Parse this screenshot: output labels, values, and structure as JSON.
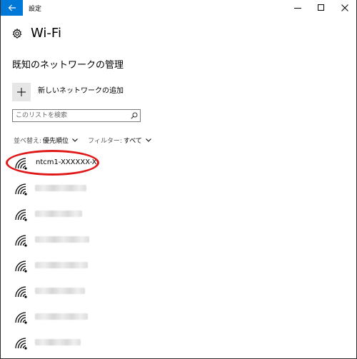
{
  "window": {
    "title": "設定",
    "accent": "#0078d7"
  },
  "header": {
    "title": "Wi-Fi"
  },
  "section": {
    "title": "既知のネットワークの管理"
  },
  "add_network": {
    "label": "新しいネットワークの追加"
  },
  "search": {
    "placeholder": "このリストを検索",
    "value": ""
  },
  "filters": {
    "sort_label": "並べ替え:",
    "sort_value": "優先順位",
    "filter_label": "フィルター:",
    "filter_value": "すべて"
  },
  "networks": [
    {
      "name": "ntcm1-XXXXXX-X",
      "highlighted": true
    },
    {
      "name": ""
    },
    {
      "name": ""
    },
    {
      "name": ""
    },
    {
      "name": ""
    },
    {
      "name": ""
    },
    {
      "name": ""
    },
    {
      "name": ""
    }
  ],
  "icons": {
    "back": "arrow-left",
    "minimize": "minimize",
    "maximize": "maximize",
    "close": "close",
    "settings": "gear",
    "add": "plus",
    "search": "magnifier",
    "wifi": "wifi-signal",
    "chevron": "chevron-down"
  },
  "highlight_color": "#e01818"
}
